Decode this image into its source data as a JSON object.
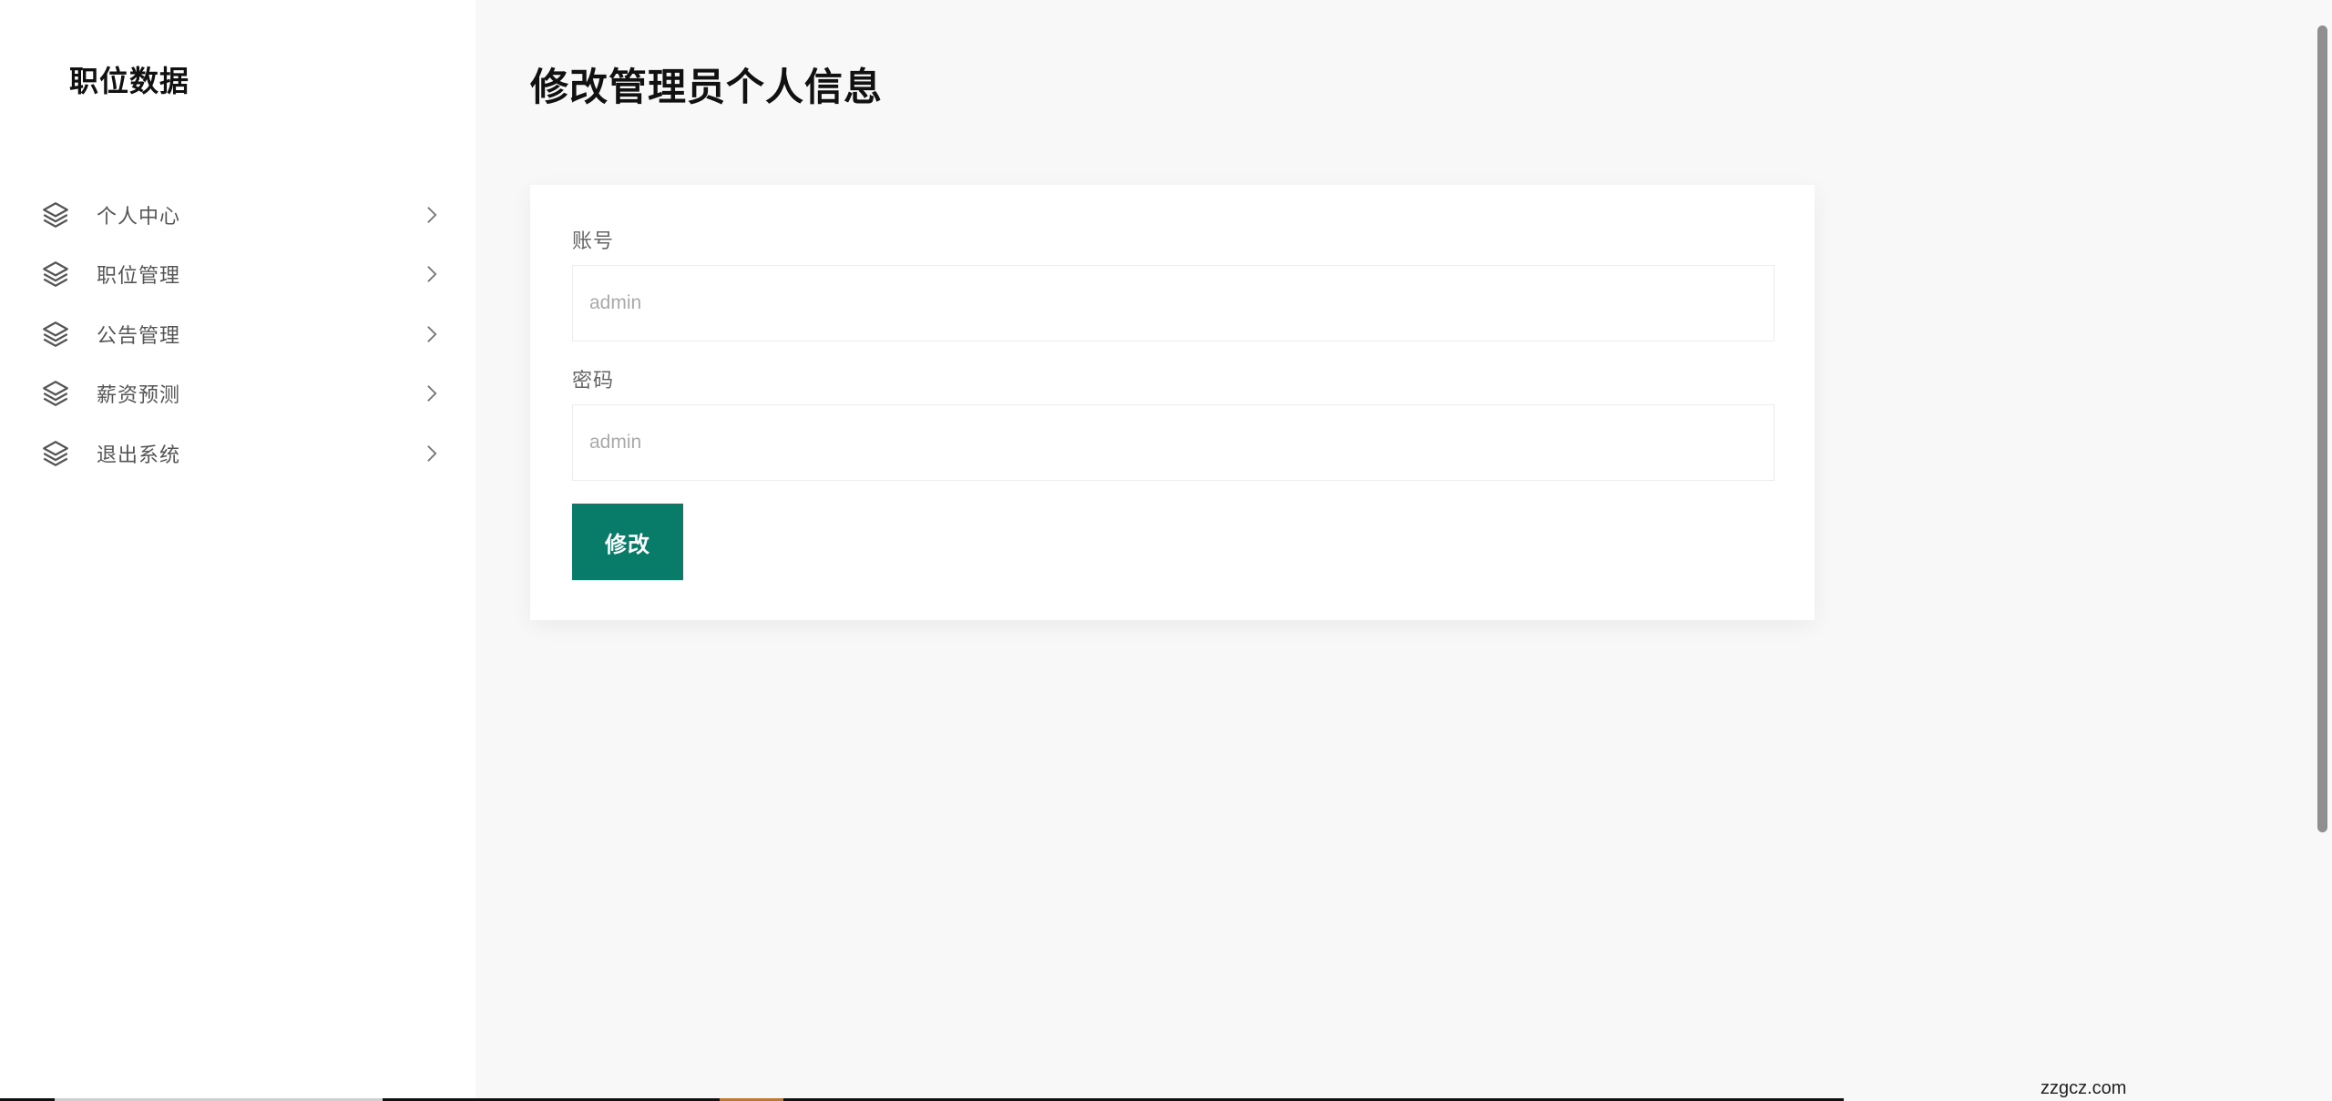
{
  "sidebar": {
    "brand": "职位数据",
    "items": [
      {
        "label": "个人中心",
        "icon": "layers-icon",
        "chevron": "chevron-right-icon"
      },
      {
        "label": "职位管理",
        "icon": "layers-icon",
        "chevron": "chevron-right-icon"
      },
      {
        "label": "公告管理",
        "icon": "layers-icon",
        "chevron": "chevron-right-icon"
      },
      {
        "label": "薪资预测",
        "icon": "layers-icon",
        "chevron": "chevron-right-icon"
      },
      {
        "label": "退出系统",
        "icon": "layers-icon",
        "chevron": "chevron-right-icon"
      }
    ]
  },
  "main": {
    "title": "修改管理员个人信息",
    "form": {
      "account_label": "账号",
      "account_placeholder": "admin",
      "password_label": "密码",
      "password_placeholder": "admin",
      "submit_label": "修改"
    }
  },
  "watermark": "zzgcz.com",
  "colors": {
    "accent": "#087c68",
    "sidebar_bg": "#ffffff",
    "page_bg": "#f8f8f8"
  }
}
